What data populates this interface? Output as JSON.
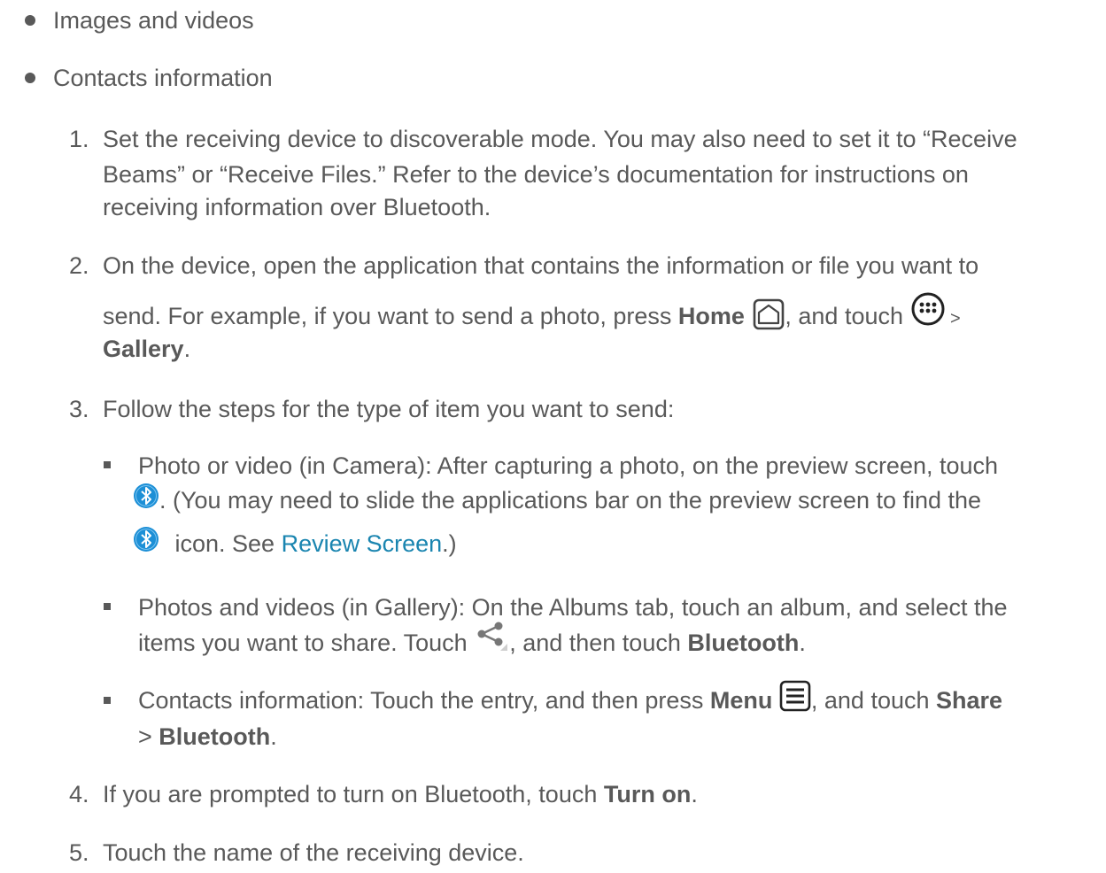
{
  "bullets": [
    {
      "text": "Images and videos"
    },
    {
      "text": "Contacts information"
    }
  ],
  "steps": [
    {
      "num": "1.",
      "lines": [
        "Set the receiving device to discoverable mode. You may also need to set it to “Receive",
        "Beams” or “Receive Files.” Refer to the device’s documentation for instructions on",
        "receiving information over Bluetooth."
      ]
    },
    {
      "num": "2.",
      "line1": "On the device, open the application that contains the information or file you want to",
      "line2_a": "send. For example, if you want to send a photo, press ",
      "line2_home": "Home",
      "line2_b": ", and touch ",
      "line2_c": " >",
      "line3_bold": "Gallery",
      "line3_end": "."
    },
    {
      "num": "3.",
      "text": "Follow the steps for the type of item you want to send:"
    },
    {
      "num": "4.",
      "text_a": "If you are prompted to turn on Bluetooth, touch ",
      "text_bold": "Turn on",
      "text_end": "."
    },
    {
      "num": "5.",
      "text": "Touch the name of the receiving device."
    }
  ],
  "subitems": {
    "photo": {
      "line1": "Photo or video (in Camera): After capturing a photo, on the preview screen, touch",
      "line2": ". (You may need to slide the applications bar on the preview screen to find the",
      "line3_a": " icon. See ",
      "line3_link": "Review Screen",
      "line3_end": ".)"
    },
    "gallery": {
      "line1": "Photos and videos (in Gallery): On the Albums tab, touch an album, and select the",
      "line2_a": "items you want to share. Touch ",
      "line2_b": ", and then touch ",
      "line2_bold": "Bluetooth",
      "line2_end": "."
    },
    "contacts": {
      "line1_a": "Contacts information: Touch the entry, and then press ",
      "line1_menu": "Menu",
      "line1_b": ", and touch ",
      "line1_share": "Share",
      "line2_a": "> ",
      "line2_bold": "Bluetooth",
      "line2_end": "."
    }
  },
  "icons": {
    "home": "home-icon",
    "apps": "apps-icon",
    "bluetooth": "bluetooth-icon",
    "share": "share-icon",
    "menu": "menu-icon"
  },
  "colors": {
    "text": "#595959",
    "link": "#1a85b0",
    "bluetooth": "#1c8fd6"
  }
}
